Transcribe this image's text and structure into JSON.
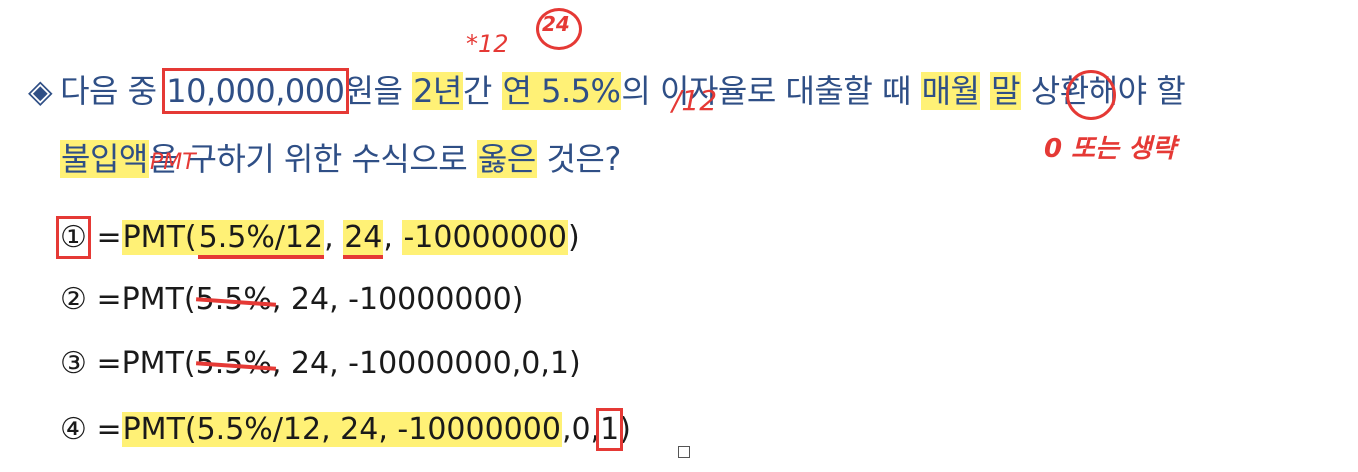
{
  "question": {
    "bullet": "◈",
    "p1": "다음 중 ",
    "amount": "10,000,000",
    "p2": "원을 ",
    "years": "2년",
    "p3": "간 ",
    "rate": "연 5.5%",
    "p4": "의 이자율로 대출할 때 ",
    "monthly": "매월",
    "p5": " ",
    "end": "말",
    "p6": " 상환해야 할",
    "line2_a": "불입액",
    "line2_b": "을 구하기 위한 수식으로 ",
    "correct": "옳은",
    "line2_c": " 것은?"
  },
  "annotations": {
    "times12": "*12",
    "circled24": "24",
    "slash12": "/12",
    "pmt": "PMT",
    "zero_or_omit": "0 또는 생략"
  },
  "options": [
    {
      "num": "①",
      "eq": " =",
      "fn": "PMT(",
      "a": "5.5%/12",
      "s1": ", ",
      "b": "24",
      "s2": ", ",
      "c": "-10000000",
      "d": ")"
    },
    {
      "num": "②",
      "eq": " =",
      "fn": "PMT(",
      "a": "5.5%",
      "s1": ", ",
      "b": "24",
      "s2": ", ",
      "c": "-10000000",
      "d": ")"
    },
    {
      "num": "③",
      "eq": " =",
      "fn": "PMT(",
      "a": "5.5%",
      "s1": ", ",
      "b": "24",
      "s2": ", ",
      "c": "-10000000",
      "d": ",0,1)"
    },
    {
      "num": "④",
      "eq": " =",
      "fn": "PMT(5.5%/12, 24, -10000000",
      "tail": ",0,",
      "one": "1",
      "close": ")"
    }
  ]
}
